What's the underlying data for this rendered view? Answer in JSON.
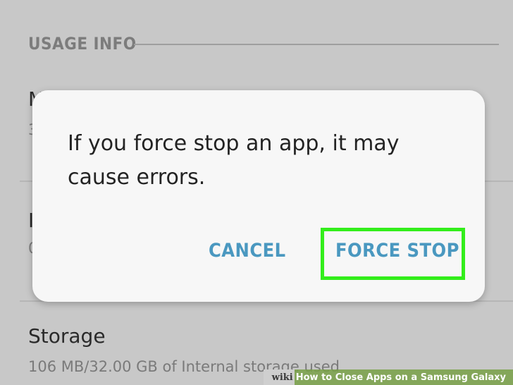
{
  "background": {
    "section_header": "USAGE INFO",
    "items": [
      {
        "title": "M",
        "subtitle": "3"
      },
      {
        "title": "I",
        "subtitle": "0"
      }
    ],
    "storage": {
      "title": "Storage",
      "subtitle": "106 MB/32.00 GB of Internal storage used"
    }
  },
  "dialog": {
    "message": "If you force stop an app, it may cause errors.",
    "cancel_label": "CANCEL",
    "force_stop_label": "FORCE STOP",
    "highlight_color": "#33ee1b",
    "button_color": "#4a98c0"
  },
  "watermark": {
    "wiki": "wiki",
    "how": "How",
    "rest": " to Close Apps on a Samsung Galaxy"
  }
}
